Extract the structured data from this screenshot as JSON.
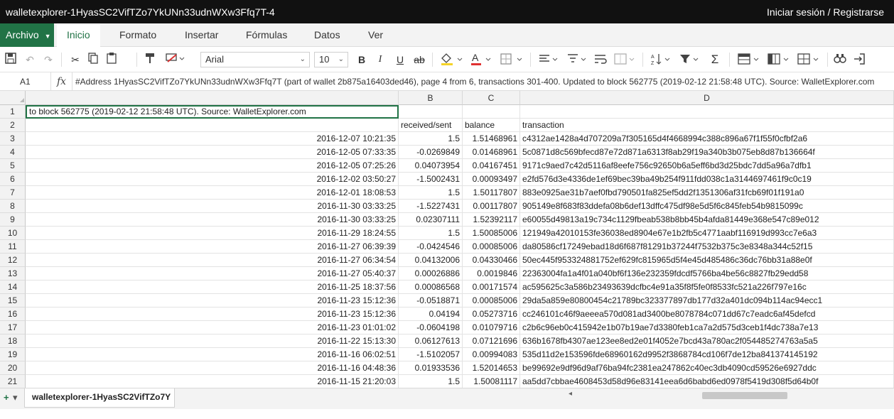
{
  "app": {
    "title": "walletexplorer-1HyasSC2VifTZo7YkUNn33udnWXw3Ffq7T-4",
    "login_label": "Iniciar sesión / Registrarse"
  },
  "menu": {
    "file_label": "Archivo",
    "tabs": [
      "Inicio",
      "Formato",
      "Insertar",
      "Fórmulas",
      "Datos",
      "Ver"
    ]
  },
  "toolbar": {
    "font_name": "Arial",
    "font_size": "10",
    "bold_label": "B",
    "italic_label": "I",
    "underline_label": "U",
    "strike_label": "ab",
    "sum_label": "Σ"
  },
  "formula_bar": {
    "cell_ref": "A1",
    "fx_label": "fx",
    "content": "#Address 1HyasSC2VifTZo7YkUNn33udnWXw3Ffq7T (part of wallet 2b875a16403ded46), page 4 from 6, transactions 301-400. Updated to block 562775 (2019-02-12 21:58:48 UTC). Source: WalletExplorer.com"
  },
  "grid": {
    "columns": [
      "",
      "B",
      "C",
      "D"
    ],
    "a1_text": "to block 562775 (2019-02-12 21:58:48 UTC). Source: WalletExplorer.com",
    "headers": [
      "",
      "received/sent",
      "balance",
      "transaction"
    ],
    "rows": [
      [
        "2016-12-07 10:21:35",
        "1.5",
        "1.51468961",
        "c4312ae1428a4d707209a7f305165d4f4668994c388c896a67f1f55f0cfbf2a6"
      ],
      [
        "2016-12-05 07:33:35",
        "-0.0269849",
        "0.01468961",
        "5c0871d8c569bfecd87e72d871a6313f8ab29f19a340b3b075eb8d87b136664f"
      ],
      [
        "2016-12-05 07:25:26",
        "0.04073954",
        "0.04167451",
        "9171c9aed7c42d5116af8eefe756c92650b6a5eff6bd3d25bdc7dd5a96a7dfb1"
      ],
      [
        "2016-12-02 03:50:27",
        "-1.5002431",
        "0.00093497",
        "e2fd576d3e4336de1ef69bec39ba49b254f911fdd038c1a3144697461f9c0c19"
      ],
      [
        "2016-12-01 18:08:53",
        "1.5",
        "1.50117807",
        "883e0925ae31b7aef0fbd790501fa825ef5dd2f1351306af31fcb69f01f191a0"
      ],
      [
        "2016-11-30 03:33:25",
        "-1.5227431",
        "0.00117807",
        "905149e8f683f83ddefa08b6def13dffc475df98e5d5f6c845feb54b9815099c"
      ],
      [
        "2016-11-30 03:33:25",
        "0.02307111",
        "1.52392117",
        "e60055d49813a19c734c1129fbeab538b8bb45b4afda81449e368e547c89e012"
      ],
      [
        "2016-11-29 18:24:55",
        "1.5",
        "1.50085006",
        "121949a42010153fe36038ed8904e67e1b2fb5c4771aabf116919d993cc7e6a3"
      ],
      [
        "2016-11-27 06:39:39",
        "-0.0424546",
        "0.00085006",
        "da80586cf17249ebad18d6f687f81291b37244f7532b375c3e8348a344c52f15"
      ],
      [
        "2016-11-27 06:34:54",
        "0.04132006",
        "0.04330466",
        "50ec445f953324881752ef629fc815965d5f4e45d485486c36dc76bb31a88e0f"
      ],
      [
        "2016-11-27 05:40:37",
        "0.00026886",
        "0.0019846",
        "22363004fa1a4f01a040bf6f136e232359fdcdf5766ba4be56c8827fb29edd58"
      ],
      [
        "2016-11-25 18:37:56",
        "0.00086568",
        "0.00171574",
        "ac595625c3a586b23493639dcfbc4e91a35f8f5fe0f8533fc521a226f797e16c"
      ],
      [
        "2016-11-23 15:12:36",
        "-0.0518871",
        "0.00085006",
        "29da5a859e80800454c21789bc323377897db177d32a401dc094b114ac94ecc1"
      ],
      [
        "2016-11-23 15:12:36",
        "0.04194",
        "0.05273716",
        "cc246101c46f9aeeea570d081ad3400be8078784c071dd67c7eadc6af45defcd"
      ],
      [
        "2016-11-23 01:01:02",
        "-0.0604198",
        "0.01079716",
        "c2b6c96eb0c415942e1b07b19ae7d3380feb1ca7a2d575d3ceb1f4dc738a7e13"
      ],
      [
        "2016-11-22 15:13:30",
        "0.06127613",
        "0.07121696",
        "636b1678fb4307ae123ee8ed2e01f4052e7bcd43a780ac2f054485274763a5a5"
      ],
      [
        "2016-11-16 06:02:51",
        "-1.5102057",
        "0.00994083",
        "535d11d2e153596fde68960162d9952f3868784cd106f7de12ba841374145192"
      ],
      [
        "2016-11-16 04:48:36",
        "0.01933536",
        "1.52014653",
        "be99692e9df96d9af76ba94fc2381ea247862c40ec3db4090cd59526e6927ddc"
      ],
      [
        "2016-11-15 21:20:03",
        "1.5",
        "1.50081117",
        "aa5dd7cbbae4608453d58d96e83141eea6d6babd6ed0978f5419d308f5d64b0f"
      ]
    ]
  },
  "sheet": {
    "tab_label": "walletexplorer-1HyasSC2VifTZo7Y"
  }
}
